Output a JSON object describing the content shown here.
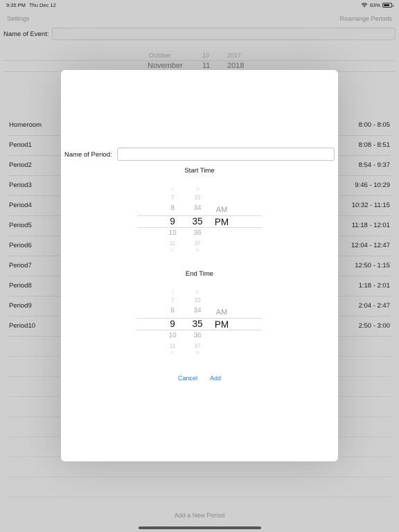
{
  "status": {
    "time": "9:35 PM",
    "date": "Thu Dec 12",
    "battery": "63%",
    "battery_level": 0.63
  },
  "nav": {
    "left": "Settings",
    "right": "Rearrange Periods"
  },
  "event": {
    "label": "Name of Event:",
    "value": ""
  },
  "date_picker": {
    "prev": {
      "month": "October",
      "day": "10",
      "year": "2017"
    },
    "selected": {
      "month": "November",
      "day": "11",
      "year": "2018"
    }
  },
  "periods": [
    {
      "name": "Homeroom",
      "time": "8:00 - 8:05"
    },
    {
      "name": "Period1",
      "time": "8:08 - 8:51"
    },
    {
      "name": "Period2",
      "time": "8:54 - 9:37"
    },
    {
      "name": "Period3",
      "time": "9:46 - 10:29"
    },
    {
      "name": "Period4",
      "time": "10:32 - 11:15"
    },
    {
      "name": "Period5",
      "time": "11:18 - 12:01"
    },
    {
      "name": "Period6",
      "time": "12:04 - 12:47"
    },
    {
      "name": "Period7",
      "time": "12:50 - 1:15"
    },
    {
      "name": "Period8",
      "time": "1:18 - 2:01"
    },
    {
      "name": "Period9",
      "time": "2:04 - 2:47"
    },
    {
      "name": "Period10",
      "time": "2:50 - 3:00"
    }
  ],
  "add_period": "Add a New Period",
  "modal": {
    "name_label": "Name of Period:",
    "name_value": "",
    "start_title": "Start Time",
    "end_title": "End Time",
    "cancel": "Cancel",
    "add": "Add"
  },
  "start_picker": {
    "hours": [
      "6",
      "7",
      "8",
      "9",
      "10",
      "11",
      "12"
    ],
    "minutes": [
      "32",
      "33",
      "34",
      "35",
      "36",
      "37",
      "38"
    ],
    "ampm": [
      "AM",
      "PM"
    ],
    "selected": {
      "hour": "9",
      "minute": "35",
      "ampm": "PM"
    }
  },
  "end_picker": {
    "hours": [
      "6",
      "7",
      "8",
      "9",
      "10",
      "11",
      "12"
    ],
    "minutes": [
      "32",
      "33",
      "34",
      "35",
      "36",
      "37",
      "38"
    ],
    "ampm": [
      "AM",
      "PM"
    ],
    "selected": {
      "hour": "9",
      "minute": "35",
      "ampm": "PM"
    }
  },
  "colors": {
    "accent": "#2a7ad6",
    "background": "#cfcfcf",
    "modal": "#ffffff"
  }
}
